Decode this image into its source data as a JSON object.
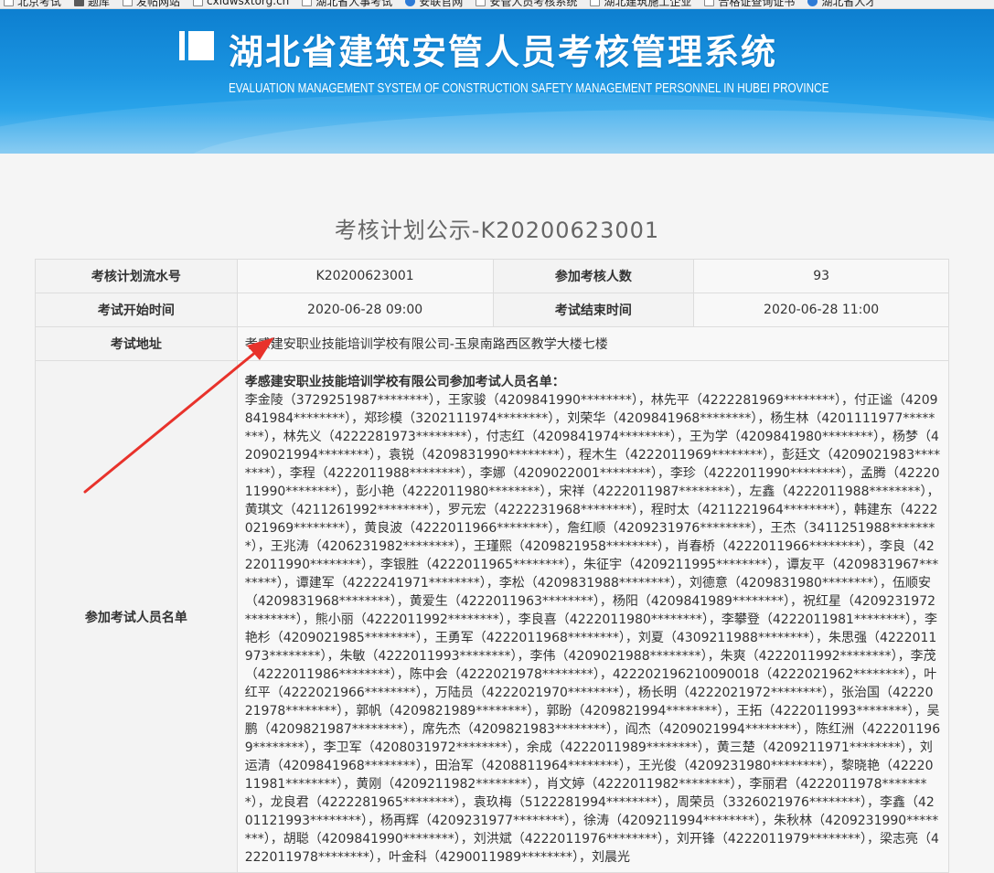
{
  "bookmarks": [
    {
      "icon": "page-icon",
      "label": "北京考试"
    },
    {
      "icon": "grid-icon",
      "label": "题库"
    },
    {
      "icon": "page-icon",
      "label": "发帖网站"
    },
    {
      "icon": "page-icon",
      "label": "cxldwsxtorg.cn"
    },
    {
      "icon": "page-icon",
      "label": "湖北省人事考试"
    },
    {
      "icon": "globe-icon",
      "label": "安联官网"
    },
    {
      "icon": "page-icon",
      "label": "安管人员考核系统"
    },
    {
      "icon": "page-icon",
      "label": "湖北建筑施工企业"
    },
    {
      "icon": "page-icon",
      "label": "合格证查询证书"
    },
    {
      "icon": "globe-icon",
      "label": "湖北省人才"
    }
  ],
  "banner": {
    "title_cn": "湖北省建筑安管人员考核管理系统",
    "title_en": "EVALUATION MANAGEMENT SYSTEM OF CONSTRUCTION SAFETY MANAGEMENT PERSONNEL IN HUBEI PROVINCE"
  },
  "page_title": "考核计划公示-K20200623001",
  "plan": {
    "serial_label": "考核计划流水号",
    "serial_value": "K20200623001",
    "count_label": "参加考核人数",
    "count_value": "93",
    "start_label": "考试开始时间",
    "start_value": "2020-06-28 09:00",
    "end_label": "考试结束时间",
    "end_value": "2020-06-28 11:00",
    "address_label": "考试地址",
    "address_value": "孝感建安职业技能培训学校有限公司-玉泉南路西区教学大楼七楼",
    "names_label": "参加考试人员名单",
    "names_heading": "孝感建安职业技能培训学校有限公司参加考试人员名单：",
    "names_text": "李金陵（3729251987********），王家骏（4209841990********），林先平（4222281969********），付正谧（4209841984********），郑珍模（3202111974********），刘荣华（4209841968********），杨生林（4201111977********），林先义（4222281973********），付志红（4209841974********），王为学（4209841980********），杨梦（4209021994********），袁锐（4209831990********），程木生（4222011969********），彭廷文（4209021983********），李程（4222011988********），李娜（4209022001********），李珍（4222011990********），孟腾（4222011990********），彭小艳（4222011980********），宋祥（4222011987********），左鑫（4222011988********），黄琪文（4211261992********），罗元宏（4222231968********），程时太（4211221964********），韩建东（4222021969********），黄良波（4222011966********），詹红顺（4209231976********），王杰（3411251988********），王兆涛（4206231982********），王瑾熙（4209821958********），肖春桥（4222011966********），李良（4222011990********），李银胜（4222011965********），朱征宇（4209211995********），谭友平（4209831967********），谭建军（4222241971********），李松（4209831988********），刘德意（4209831980********），伍顺安（4209831968********），黄爱生（4222011963********），杨阳（4209841989********），祝红星（4209231972********），熊小丽（4222011992********），李良喜（4222011980********），李攀登（4222011981********），李艳杉（4209021985********），王勇军（4222011968********），刘夏（4309211988********），朱思强（4222011973********），朱敏（4222011993********），李伟（4209021988********），朱爽（4222011992********），李茂（4222011986********），陈中会（4222021978********），422202196210090018（4222021962********），叶红平（4222021966********），万陆员（4222021970********），杨长明（4222021972********），张治国（4222021978********），郭帆（4209821989********），郭盼（4209821994********），王拓（4222011993********），吴鹏（4209821987********），席先杰（4209821983********），阎杰（4209021994********），陈红洲（4222011969********），李卫军（4208031972********），余成（4222011989********），黄三楚（4209211971********），刘运清（4209841968********），田治军（4208811964********），王光俊（4209231980********），黎晓艳（4222011981********），黄刚（4209211982********），肖文婷（4222011982********），李丽君（4222011978********），龙良君（4222281965********），袁玖梅（5122281994********），周荣员（3326021976********），李鑫（4201121993********），杨再辉（4209231977********），徐涛（4209211994********），朱秋林（4209231990********），胡聪（4209841990********），刘洪斌（4222011976********），刘开锋（4222011979********），梁志亮（4222011978********），叶金科（4290011989********），刘晨光"
  },
  "colors": {
    "banner_top": "#0d7fd0",
    "banner_bottom": "#7cc6f1",
    "annotation_arrow": "#e8322b",
    "table_border": "#dddddd"
  }
}
